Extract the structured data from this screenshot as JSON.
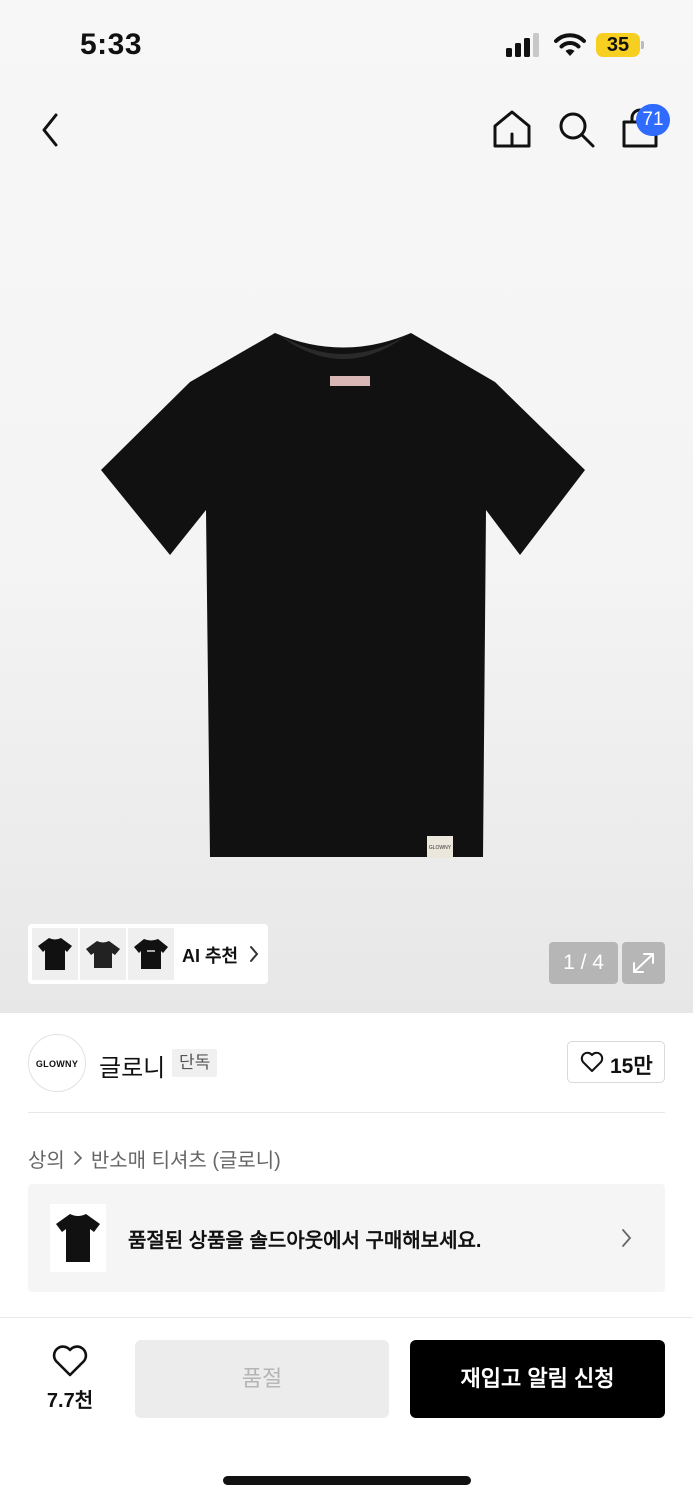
{
  "status_bar": {
    "time": "5:33",
    "battery": "35"
  },
  "nav": {
    "cart_count": "71"
  },
  "gallery": {
    "page_indicator": "1 / 4",
    "ai_recommend_label": "AI 추천",
    "product_label_text": "GLOWNY"
  },
  "brand": {
    "logo_text": "GLOWNY",
    "name": "글로니",
    "tag": "단독",
    "like_count": "15만"
  },
  "breadcrumb": {
    "items": [
      "상의",
      "반소매 티셔츠 (글로니)"
    ]
  },
  "soldout_banner": {
    "text": "품절된 상품을 솔드아웃에서 구매해보세요."
  },
  "bottom_bar": {
    "wish_count": "7.7천",
    "soldout_label": "품절",
    "restock_label": "재입고 알림 신청"
  },
  "colors": {
    "badge_blue": "#2f6bff",
    "battery_yellow": "#f7cf21",
    "primary_button": "#000000"
  }
}
